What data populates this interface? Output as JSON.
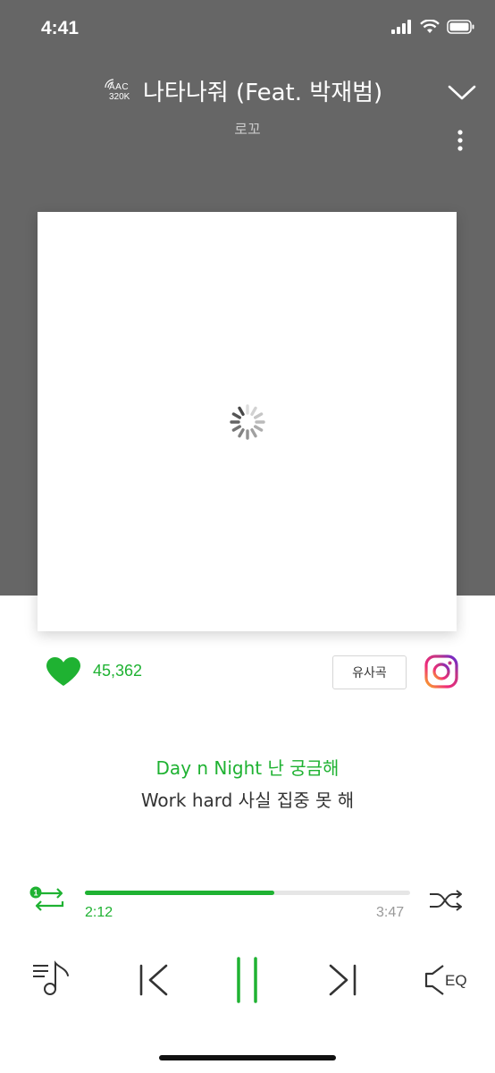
{
  "status_bar": {
    "time": "4:41"
  },
  "header": {
    "codec": "AAC",
    "bitrate": "320K",
    "title": "나타나줘 (Feat. 박재범)",
    "artist": "로꼬"
  },
  "likes": {
    "count": "45,362"
  },
  "similar_label": "유사곡",
  "lyrics": {
    "current": "Day n Night 난 궁금해",
    "next": "Work hard 사실 집중 못 해"
  },
  "player": {
    "elapsed": "2:12",
    "total": "3:47",
    "progress": 0.583,
    "repeat_badge": "1",
    "eq_label": "EQ"
  },
  "colors": {
    "accent": "#1fb232",
    "header_bg": "#666666"
  }
}
